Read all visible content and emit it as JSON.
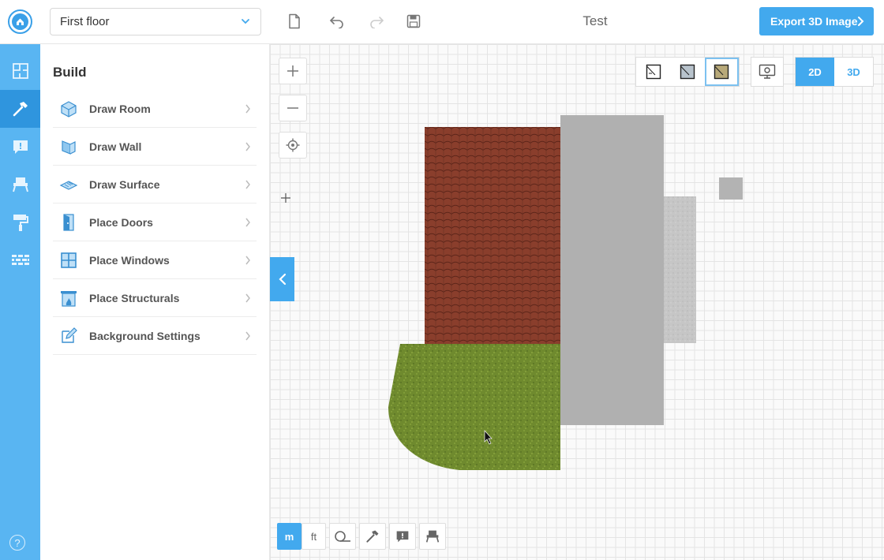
{
  "topbar": {
    "floor_selected": "First floor",
    "title": "Test",
    "export_label": "Export 3D Image"
  },
  "panel": {
    "title": "Build",
    "items": [
      {
        "label": "Draw Room",
        "icon": "draw-room-icon"
      },
      {
        "label": "Draw Wall",
        "icon": "draw-wall-icon"
      },
      {
        "label": "Draw Surface",
        "icon": "draw-surface-icon"
      },
      {
        "label": "Place Doors",
        "icon": "door-icon"
      },
      {
        "label": "Place Windows",
        "icon": "window-icon"
      },
      {
        "label": "Place Structurals",
        "icon": "fireplace-icon"
      },
      {
        "label": "Background Settings",
        "icon": "pencil-icon"
      }
    ]
  },
  "rail": {
    "items": [
      "floorplan-icon",
      "hammer-icon",
      "comment-icon",
      "chair-icon",
      "paint-roller-icon",
      "brick-wall-icon"
    ],
    "active_index": 1,
    "help_glyph": "?"
  },
  "canvas": {
    "view_toggle": {
      "option_2d": "2D",
      "option_3d": "3D",
      "selected": "2D"
    },
    "units": {
      "metric": "m",
      "imperial": "ft",
      "selected": "m"
    }
  },
  "colors": {
    "accent": "#42a9ee",
    "rail": "#59b5f2",
    "rail_active": "#2f95de",
    "roof_tiles": "#8a3e2c",
    "grass": "#6f8a2e",
    "wall_gray": "#b0b0b0",
    "concrete": "#c6c6c6"
  }
}
